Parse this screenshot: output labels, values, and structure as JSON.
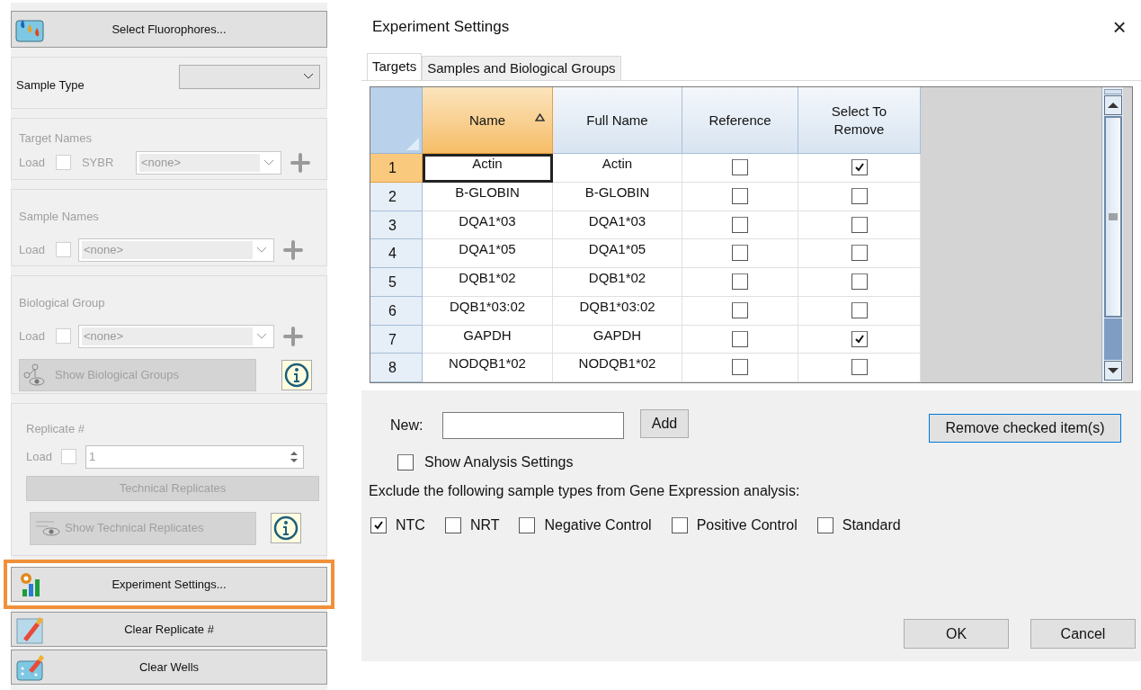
{
  "sidebar": {
    "top_button": {
      "label": "Select Fluorophores..."
    },
    "sample_type": {
      "label": "Sample Type"
    },
    "groups": [
      {
        "title": "Target Names",
        "load_label": "Load",
        "load_checked": false,
        "dye": "SYBR",
        "select": "<none>",
        "disabled": true
      },
      {
        "title": "Sample Names",
        "load_label": "Load",
        "load_checked": false,
        "select": "<none>",
        "disabled": true
      },
      {
        "title": "Biological Group",
        "load_label": "Load",
        "load_checked": false,
        "select": "<none>",
        "disabled": true,
        "show_button": "Show Biological Groups"
      }
    ],
    "replicate": {
      "title": "Replicate #",
      "load_label": "Load",
      "load_checked": false,
      "value": "1",
      "disabled": true,
      "tech_button": "Technical Replicates",
      "show_button": "Show Technical Replicates"
    },
    "bottom_buttons": [
      {
        "label": "Experiment Settings...",
        "kind": "settings",
        "highlighted": true
      },
      {
        "label": "Clear Replicate #",
        "kind": "clear-replicate",
        "highlighted": false
      },
      {
        "label": "Clear Wells",
        "kind": "clear-wells",
        "highlighted": false
      }
    ]
  },
  "dialog": {
    "title": "Experiment Settings",
    "close": "×",
    "tabs": [
      {
        "label": "Targets",
        "selected": true
      },
      {
        "label": "Samples and Biological Groups",
        "selected": false
      }
    ],
    "table": {
      "columns": [
        {
          "label": "Name",
          "sorted": true
        },
        {
          "label": "Full Name",
          "sorted": false
        },
        {
          "label": "Reference",
          "sorted": false
        },
        {
          "label": "Select To Remove",
          "sorted": false
        }
      ],
      "rows": [
        {
          "number": "1",
          "name": "Actin",
          "full_name": "Actin",
          "reference": false,
          "remove": true,
          "selected": true
        },
        {
          "number": "2",
          "name": "B-GLOBIN",
          "full_name": "B-GLOBIN",
          "reference": false,
          "remove": false,
          "selected": false
        },
        {
          "number": "3",
          "name": "DQA1*03",
          "full_name": "DQA1*03",
          "reference": false,
          "remove": false,
          "selected": false
        },
        {
          "number": "4",
          "name": "DQA1*05",
          "full_name": "DQA1*05",
          "reference": false,
          "remove": false,
          "selected": false
        },
        {
          "number": "5",
          "name": "DQB1*02",
          "full_name": "DQB1*02",
          "reference": false,
          "remove": false,
          "selected": false
        },
        {
          "number": "6",
          "name": "DQB1*03:02",
          "full_name": "DQB1*03:02",
          "reference": false,
          "remove": false,
          "selected": false
        },
        {
          "number": "7",
          "name": "GAPDH",
          "full_name": "GAPDH",
          "reference": false,
          "remove": true,
          "selected": false
        },
        {
          "number": "8",
          "name": "NODQB1*02",
          "full_name": "NODQB1*02",
          "reference": false,
          "remove": false,
          "selected": false
        }
      ]
    },
    "new_label": "New:",
    "add_button": "Add",
    "remove_button": "Remove checked item(s)",
    "show_analysis": {
      "label": "Show Analysis Settings",
      "checked": false
    },
    "exclude_label": "Exclude the following sample types from Gene Expression analysis:",
    "exclude": [
      {
        "label": "NTC",
        "checked": true
      },
      {
        "label": "NRT",
        "checked": false
      },
      {
        "label": "Negative Control",
        "checked": false
      },
      {
        "label": "Positive Control",
        "checked": false
      },
      {
        "label": "Standard",
        "checked": false
      }
    ],
    "ok": "OK",
    "cancel": "Cancel"
  }
}
